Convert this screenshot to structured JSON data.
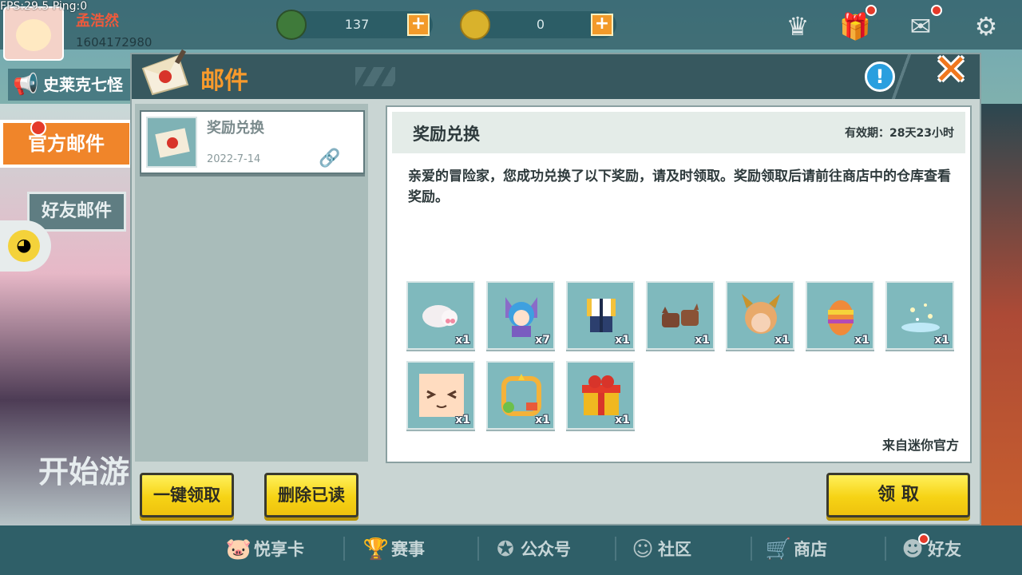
{
  "hud": {
    "fps": "FPS:29.5  Ping:0",
    "username": "孟浩然",
    "uid": "1604172980",
    "currency_1": "137",
    "currency_2": "0"
  },
  "left_panel": {
    "notice": "史莱克七怪",
    "tab_official": "官方邮件",
    "tab_friend": "好友邮件",
    "start_game": "开始游"
  },
  "dialog": {
    "title": "邮件",
    "info_icon": "!",
    "close_icon": "✕",
    "mail_list": [
      {
        "name": "奖励兑换",
        "date": "2022-7-14"
      }
    ],
    "buttons": {
      "claim_all": "一键领取",
      "delete_read": "删除已读",
      "claim": "领 取"
    },
    "detail": {
      "title": "奖励兑换",
      "validity": "有效期：28天23小时",
      "body": "亲爱的冒险家，您成功兑换了以下奖励，请及时领取。奖励领取后请前往商店中的仓库查看奖励。",
      "sender": "来自迷你官方",
      "rewards": [
        {
          "icon": "white-plush-icon",
          "qty": "x1"
        },
        {
          "icon": "blue-hair-character-icon",
          "qty": "x7"
        },
        {
          "icon": "outfit-icon",
          "qty": "x1"
        },
        {
          "icon": "brown-cats-icon",
          "qty": "x1"
        },
        {
          "icon": "horned-helmet-icon",
          "qty": "x1"
        },
        {
          "icon": "easter-egg-icon",
          "qty": "x1"
        },
        {
          "icon": "sparkle-effect-icon",
          "qty": "x1"
        },
        {
          "icon": "smiley-face-icon",
          "qty": "x1"
        },
        {
          "icon": "avatar-frame-icon",
          "qty": "x1"
        },
        {
          "icon": "gift-box-icon",
          "qty": "x1"
        }
      ]
    }
  },
  "bottom_nav": [
    {
      "label": "悦享卡",
      "icon": "pig-icon"
    },
    {
      "label": "赛事",
      "icon": "trophy-icon"
    },
    {
      "label": "公众号",
      "icon": "star-badge-icon"
    },
    {
      "label": "社区",
      "icon": "community-icon"
    },
    {
      "label": "商店",
      "icon": "cart-icon"
    },
    {
      "label": "好友",
      "icon": "friend-icon"
    }
  ],
  "colors": {
    "accent_orange": "#f89a2c",
    "button_yellow": "#f6d315",
    "header_teal": "#37585f"
  }
}
